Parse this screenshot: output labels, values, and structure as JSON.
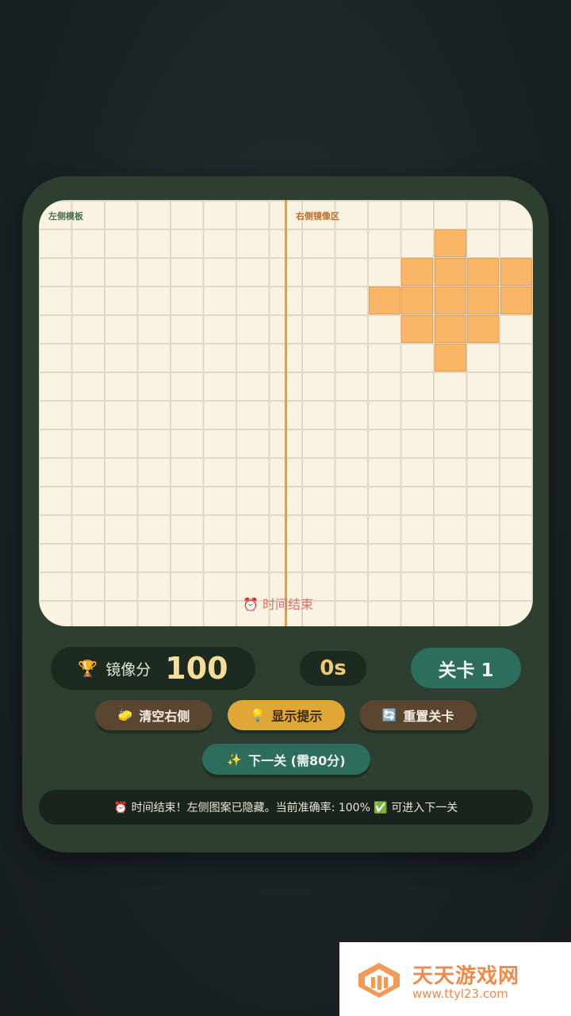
{
  "board": {
    "left_label": "左侧模板",
    "right_label": "右侧镜像区",
    "time_up_text": "⏰ 时间结束",
    "grid_columns": 15,
    "grid_rows": 15,
    "filled_cells": [
      {
        "col": 12,
        "row": 1
      },
      {
        "col": 11,
        "row": 2
      },
      {
        "col": 12,
        "row": 2
      },
      {
        "col": 13,
        "row": 2
      },
      {
        "col": 14,
        "row": 2
      },
      {
        "col": 10,
        "row": 3
      },
      {
        "col": 11,
        "row": 3
      },
      {
        "col": 12,
        "row": 3
      },
      {
        "col": 13,
        "row": 3
      },
      {
        "col": 14,
        "row": 3
      },
      {
        "col": 11,
        "row": 4
      },
      {
        "col": 12,
        "row": 4
      },
      {
        "col": 13,
        "row": 4
      },
      {
        "col": 12,
        "row": 5
      }
    ],
    "fill_color": "#fbb566",
    "divider_color": "#f0a02a"
  },
  "stats": {
    "score_icon": "🏆",
    "score_label": "镜像分",
    "score_value": "100",
    "timer": "0s",
    "level": "关卡 1"
  },
  "buttons": {
    "clear": {
      "icon": "🧽",
      "label": "清空右侧"
    },
    "hint": {
      "icon": "💡",
      "label": "显示提示"
    },
    "reset": {
      "icon": "🔄",
      "label": "重置关卡"
    },
    "next": {
      "icon": "✨",
      "label": "下一关 (需80分)"
    }
  },
  "status": {
    "message": "⏰ 时间结束！左侧图案已隐藏。当前准确率: 100% ✅ 可进入下一关"
  },
  "watermark": {
    "title": "天天游戏网",
    "url": "www.ttyl23.com"
  }
}
